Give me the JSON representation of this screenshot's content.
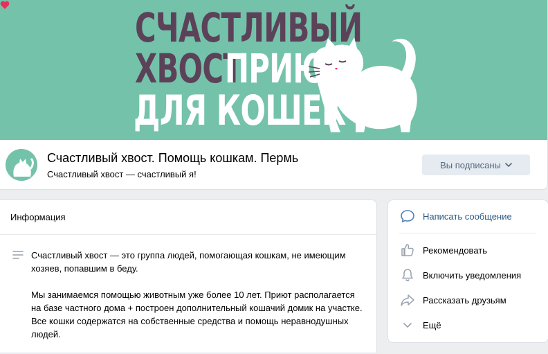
{
  "cover": {
    "logo_line1": "СЧАСТЛИВЫЙ",
    "logo_line2a": "ХВОСТ",
    "logo_line2b": "ПРИЮТ",
    "logo_line3": "ДЛЯ КОШЕК",
    "background_color": "#74c2aa",
    "accent_color": "#5c4259",
    "heart_color": "#e5325a"
  },
  "header": {
    "title": "Счастливый хвост. Помощь кошкам. Пермь",
    "status": "Счастливый хвост — счастливый я!",
    "subscribe_button": "Вы подписаны",
    "subscribe_icon": "chevron-down-icon"
  },
  "info": {
    "heading": "Информация",
    "paragraph1": "Счастливый хвост — это группа людей, помогающая кошкам, не имеющим хозяев, попавшим в беду.",
    "paragraph2": "Мы занимаемся помощью животным уже более 10 лет. Приют располагается на базе частного дома + построен дополнительный кошачий домик на участке. Все кошки содержатся на собственные средства и помощь неравнодушных людей."
  },
  "actions": {
    "message": "Написать сообщение",
    "recommend": "Рекомендовать",
    "notifications": "Включить уведомления",
    "share": "Рассказать друзьям",
    "more": "Ещё"
  }
}
